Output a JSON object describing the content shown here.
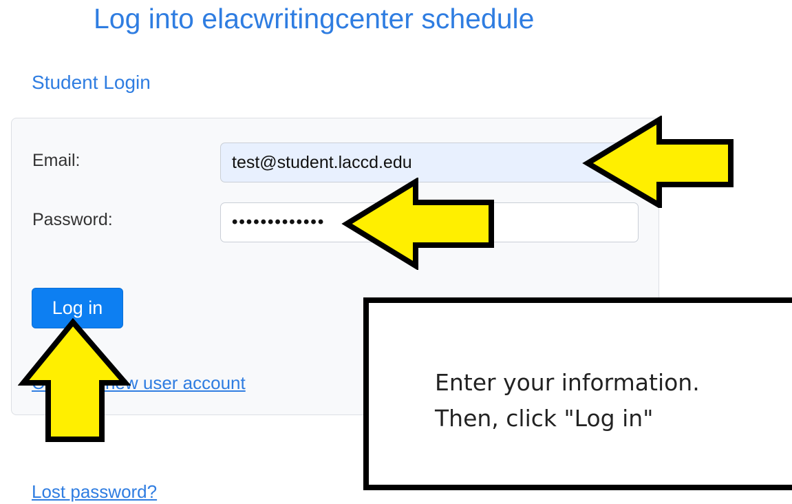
{
  "page": {
    "title": "Log into elacwritingcenter schedule",
    "section_title": "Student Login"
  },
  "form": {
    "email_label": "Email:",
    "email_value": "test@student.laccd.edu",
    "password_label": "Password:",
    "password_value": "•••••••••••••",
    "login_button": "Log in",
    "create_account_link": "Create a new user account",
    "lost_password_link": "Lost password?"
  },
  "callout": {
    "line1": "Enter your information.",
    "line2": "Then, click \"Log in\""
  },
  "colors": {
    "accent_blue": "#2f7de1",
    "button_blue": "#0d7ff2",
    "arrow_yellow": "#ffef00",
    "arrow_outline": "#000000"
  }
}
